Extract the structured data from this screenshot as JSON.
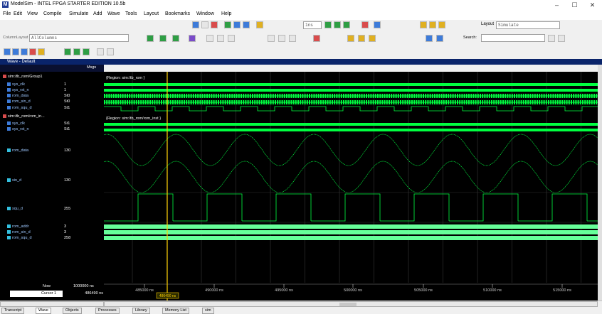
{
  "window": {
    "title": "ModelSim - INTEL FPGA STARTER EDITION 10.5b",
    "logo": "M",
    "controls": [
      "–",
      "☐",
      "✕"
    ]
  },
  "menu": [
    "File",
    "Edit",
    "View",
    "Compile",
    "Simulate",
    "Add",
    "Wave",
    "Tools",
    "Layout",
    "Bookmarks",
    "Window",
    "Help"
  ],
  "toolbar": {
    "run_length": "1ns",
    "layout_label": "Layout",
    "layout_value": "Simulate",
    "column_layout_label": "ColumnLayout",
    "column_layout_value": "AllColumns",
    "search_label": "Search:"
  },
  "wave": {
    "title": "Wave - Default",
    "msgs_label": "Msgs",
    "signals": [
      {
        "name": "sim:/tb_rom/Group1",
        "value": "",
        "kind": "group"
      },
      {
        "name": "sys_clk",
        "value": "1",
        "kind": "sig"
      },
      {
        "name": "sys_rst_n",
        "value": "1",
        "kind": "sig"
      },
      {
        "name": "rom_data",
        "value": "St0",
        "kind": "sig"
      },
      {
        "name": "rom_sin_d",
        "value": "St0",
        "kind": "sig"
      },
      {
        "name": "rom_squ_d",
        "value": "St1",
        "kind": "sig"
      },
      {
        "name": "sim:/tb_rom/rom_in...",
        "value": "",
        "kind": "group"
      },
      {
        "name": "sys_clk",
        "value": "St1",
        "kind": "sig"
      },
      {
        "name": "sys_rst_n",
        "value": "St1",
        "kind": "sig"
      },
      {
        "name": "rom_data",
        "value": "130",
        "kind": "analog"
      },
      {
        "name": "sin_d",
        "value": "130",
        "kind": "analog"
      },
      {
        "name": "squ_d",
        "value": "255",
        "kind": "analog"
      },
      {
        "name": "rom_addr",
        "value": "3",
        "kind": "bus"
      },
      {
        "name": "rom_sin_d",
        "value": "3",
        "kind": "bus"
      },
      {
        "name": "rom_squ_d",
        "value": "258",
        "kind": "bus"
      }
    ],
    "region1": "{Region: sim:/tb_rom }",
    "region2": "{Region: sim:/tb_rom/rom_inst }",
    "now_label": "Now",
    "now_value": "1000000 ns",
    "cursor_label": "Cursor 1",
    "cursor_value": "486490 ns",
    "cursor_marker": "486490 ns",
    "time_ticks": [
      "485000 ns",
      "490000 ns",
      "495000 ns",
      "500000 ns",
      "505000 ns",
      "510000 ns",
      "515000 ns"
    ]
  },
  "tabs": [
    "Transcript",
    "Wave",
    "Objects",
    "Processes",
    "Library",
    "Memory List",
    "sim"
  ],
  "colors": {
    "wave_green": "#00ff40",
    "cursor": "#ffd000",
    "pane_bg": "#000000",
    "selection": "#5a7ab0"
  }
}
